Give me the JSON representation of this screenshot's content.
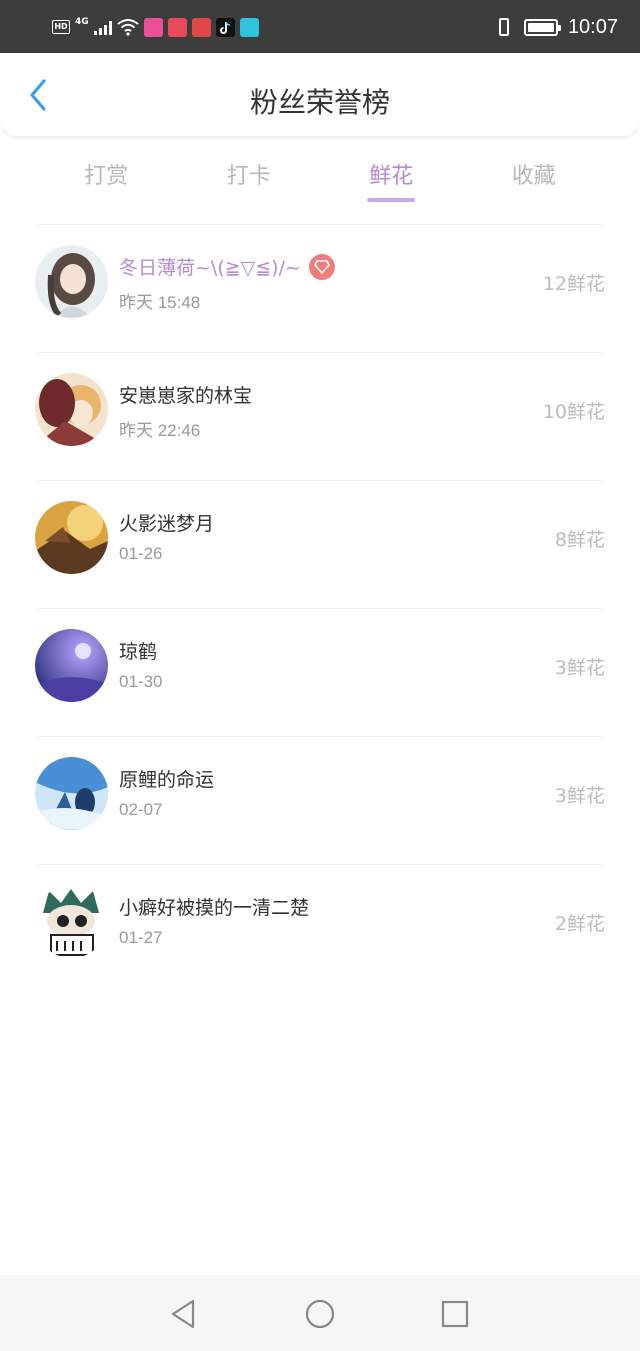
{
  "status_bar": {
    "time": "10:07",
    "left_icons": [
      "hd-icon",
      "4g-signal-icon",
      "wifi-icon",
      "app-icons"
    ]
  },
  "header": {
    "title": "粉丝荣誉榜",
    "back_icon": "chevron-left-icon"
  },
  "tabs": [
    {
      "label": "打赏",
      "active": false
    },
    {
      "label": "打卡",
      "active": false
    },
    {
      "label": "鲜花",
      "active": true
    },
    {
      "label": "收藏",
      "active": false
    }
  ],
  "list": [
    {
      "name": "冬日薄荷~\\(≧▽≦)/~",
      "time": "昨天 15:48",
      "amount": "12鲜花",
      "vip": true
    },
    {
      "name": "安崽崽家的林宝",
      "time": "昨天 22:46",
      "amount": "10鲜花",
      "vip": false
    },
    {
      "name": "火影迷梦月",
      "time": "01-26",
      "amount": "8鲜花",
      "vip": false
    },
    {
      "name": "琼鹤",
      "time": "01-30",
      "amount": "3鲜花",
      "vip": false
    },
    {
      "name": "原鲤的命运",
      "time": "02-07",
      "amount": "3鲜花",
      "vip": false
    },
    {
      "name": "小癖好被摸的一清二楚",
      "time": "01-27",
      "amount": "2鲜花",
      "vip": false
    }
  ],
  "colors": {
    "accent": "#b58ad6",
    "back_arrow": "#3a9ee8",
    "vip_badge": "#f07d7d"
  }
}
